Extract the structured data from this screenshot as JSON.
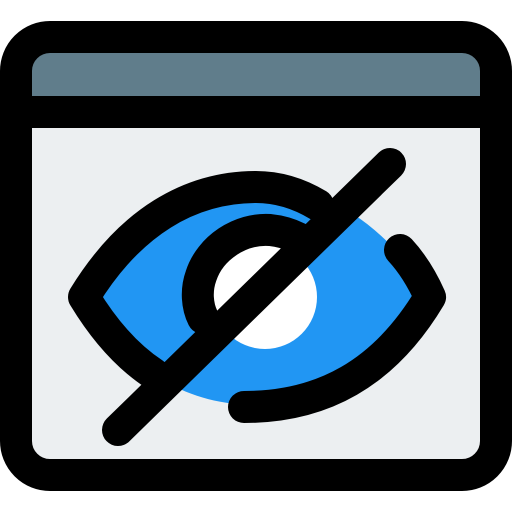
{
  "icon": {
    "name": "browser-hidden-eye-icon",
    "colors": {
      "outline": "#000000",
      "title_bar": "#607D8B",
      "window_body": "#ECEFF1",
      "iris": "#2196F3",
      "pupil": "#FFFFFF"
    }
  }
}
